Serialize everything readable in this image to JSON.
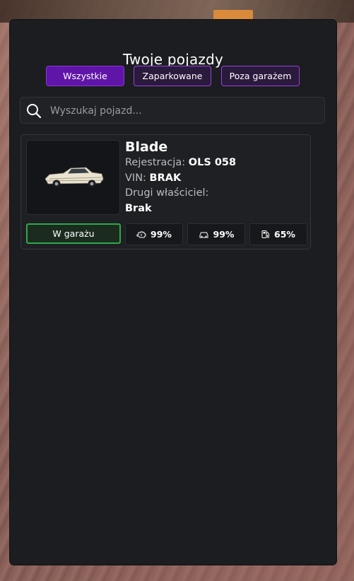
{
  "panel": {
    "title": "Twoje pojazdy"
  },
  "tabs": [
    {
      "label": "Wszystkie",
      "active": true
    },
    {
      "label": "Zaparkowane",
      "active": false
    },
    {
      "label": "Poza garażem",
      "active": false
    }
  ],
  "search": {
    "placeholder": "Wyszukaj pojazd...",
    "value": "",
    "icon": "search-icon"
  },
  "vehicles": [
    {
      "name": "Blade",
      "plate_label": "Rejestracja:",
      "plate": "OLS 058",
      "vin_label": "VIN:",
      "vin": "BRAK",
      "co_owner_label": "Drugi właściciel:",
      "co_owner": "Brak",
      "status": "W garażu",
      "stats": {
        "engine": "99%",
        "body": "99%",
        "fuel": "65%"
      },
      "icons": {
        "image": "car-image",
        "engine": "engine-icon",
        "body": "car-body-icon",
        "fuel": "fuel-pump-icon"
      }
    }
  ],
  "colors": {
    "accent": "#5f16a8",
    "tab_border": "#9b3fe0",
    "status_green": "#2fa84a",
    "panel_bg": "#1b1d20"
  }
}
